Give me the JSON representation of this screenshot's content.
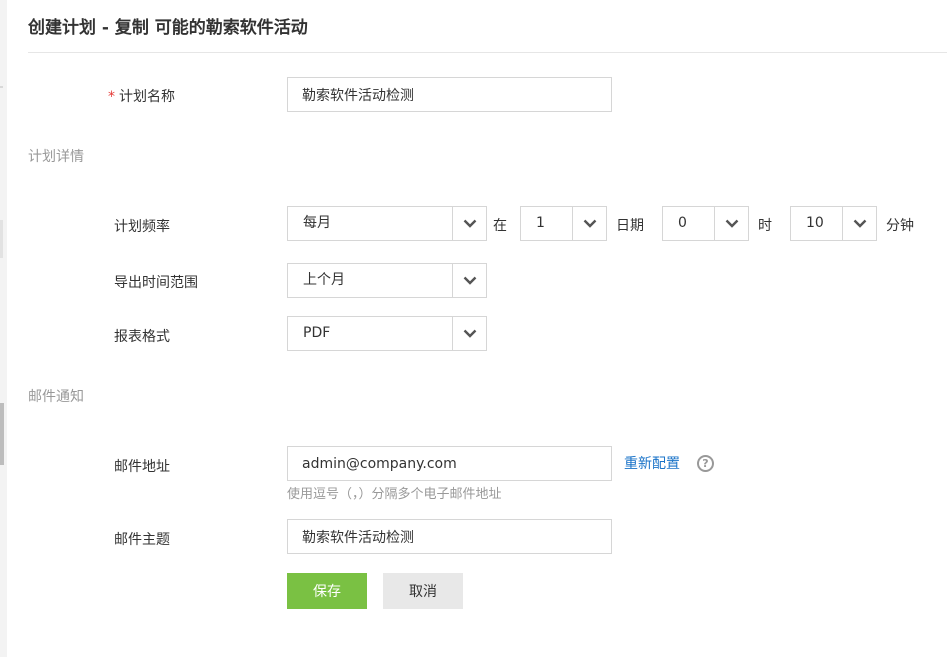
{
  "page_title": "创建计划 - 复制 可能的勒索软件活动",
  "schedule_name": {
    "required_mark": "*",
    "label": "计划名称",
    "value": "勒索软件活动检测"
  },
  "schedule_details": {
    "section_title": "计划详情",
    "frequency": {
      "label": "计划频率",
      "value": "每月",
      "at_text": "在",
      "day_value": "1",
      "day_text": "日期",
      "hour_value": "0",
      "hour_text": "时",
      "minute_value": "10",
      "minute_text": "分钟"
    },
    "export_range": {
      "label": "导出时间范围",
      "value": "上个月"
    },
    "report_format": {
      "label": "报表格式",
      "value": "PDF"
    }
  },
  "email_notification": {
    "section_title": "邮件通知",
    "address": {
      "label": "邮件地址",
      "value": "admin@company.com",
      "hint": "使用逗号（，）分隔多个电子邮件地址",
      "reconfigure_link": "重新配置",
      "help_glyph": "?"
    },
    "subject": {
      "label": "邮件主题",
      "value": "勒索软件活动检测"
    }
  },
  "actions": {
    "save_label": "保存",
    "cancel_label": "取消"
  },
  "colors": {
    "primary_button": "#7ac143",
    "link": "#1a73c8",
    "required": "#e53935",
    "section_title": "#999999"
  },
  "icons": {
    "dropdown": "chevron-down-icon",
    "help": "help-icon"
  }
}
